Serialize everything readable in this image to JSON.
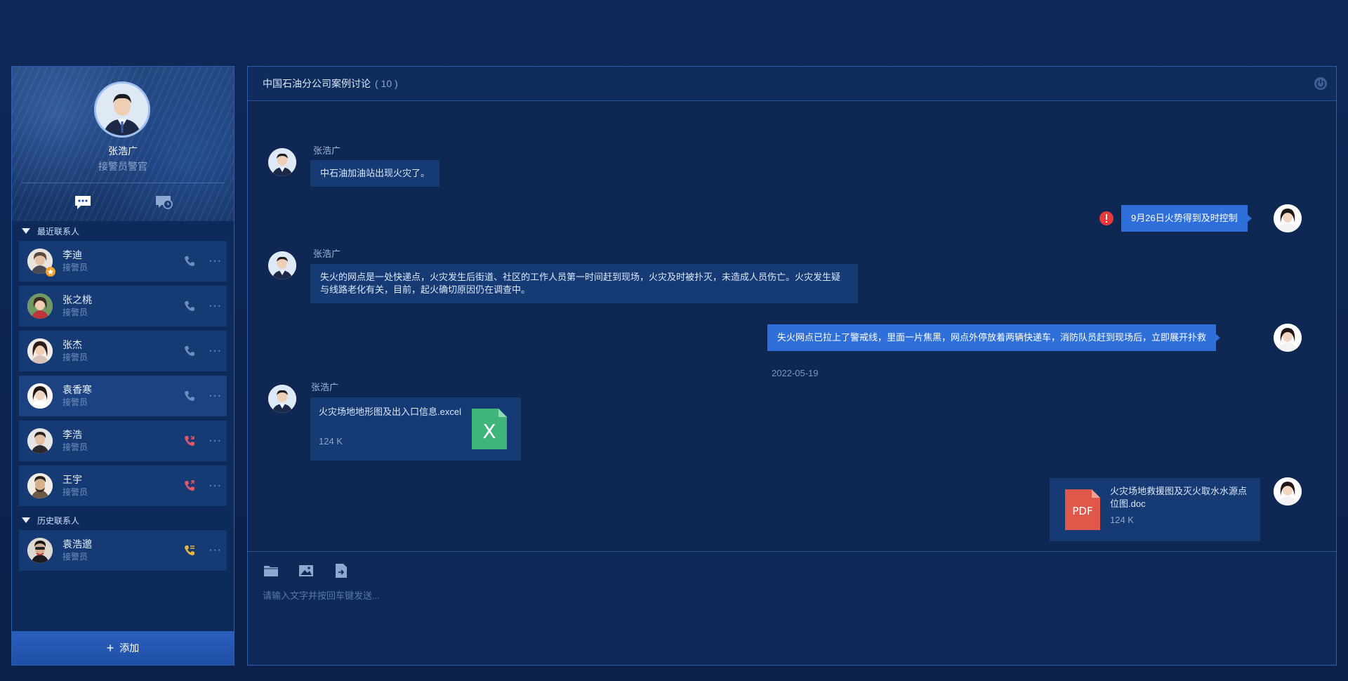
{
  "profile": {
    "name": "张浩广",
    "role": "接警员警官"
  },
  "sections": {
    "recent": "最近联系人",
    "history": "历史联系人"
  },
  "contacts": [
    {
      "name": "李迪",
      "role": "接警员",
      "call": "normal",
      "badge": true
    },
    {
      "name": "张之桃",
      "role": "接警员",
      "call": "normal"
    },
    {
      "name": "张杰",
      "role": "接警员",
      "call": "normal"
    },
    {
      "name": "袁香寒",
      "role": "接警员",
      "call": "normal",
      "selected": true
    },
    {
      "name": "李浩",
      "role": "接警员",
      "call": "missed"
    },
    {
      "name": "王宇",
      "role": "接警员",
      "call": "outgoing"
    }
  ],
  "history_contacts": [
    {
      "name": "袁浩邈",
      "role": "接警员",
      "call": "incoming"
    }
  ],
  "add_button": {
    "label": "添加"
  },
  "chat": {
    "title": "中国石油分公司案例讨论",
    "count": "( 10 )",
    "messages": [
      {
        "side": "left",
        "sender": "张浩广",
        "text": "中石油加油站出现火灾了。"
      },
      {
        "side": "right",
        "text": "9月26日火势得到及时控制",
        "error": true
      },
      {
        "side": "left",
        "sender": "张浩广",
        "text": "失火的网点是一处快递点，火灾发生后街道、社区的工作人员第一时间赶到现场，火灾及时被扑灭，未造成人员伤亡。火灾发生疑与线路老化有关，目前，起火确切原因仍在调查中。"
      },
      {
        "side": "right",
        "text": "失火网点已拉上了警戒线，里面一片焦黑，网点外停放着两辆快递车，消防队员赶到现场后，立即展开扑救"
      }
    ],
    "date": "2022-05-19",
    "file_left": {
      "sender": "张浩广",
      "name": "火灾场地地形图及出入口信息.excel",
      "size": "124 K",
      "icon_text": "X"
    },
    "file_right": {
      "name": "火灾场地救援图及灭火取水水源点位图.doc",
      "size": "124 K",
      "icon_text": "PDF"
    },
    "input_placeholder": "请输入文字并按回车键发送..."
  },
  "colors": {
    "accent": "#2f6fd9",
    "excel": "#3fb57c",
    "pdf": "#e0584a",
    "missed": "#e05a6a",
    "incoming": "#e5b640",
    "error": "#e5393b"
  }
}
